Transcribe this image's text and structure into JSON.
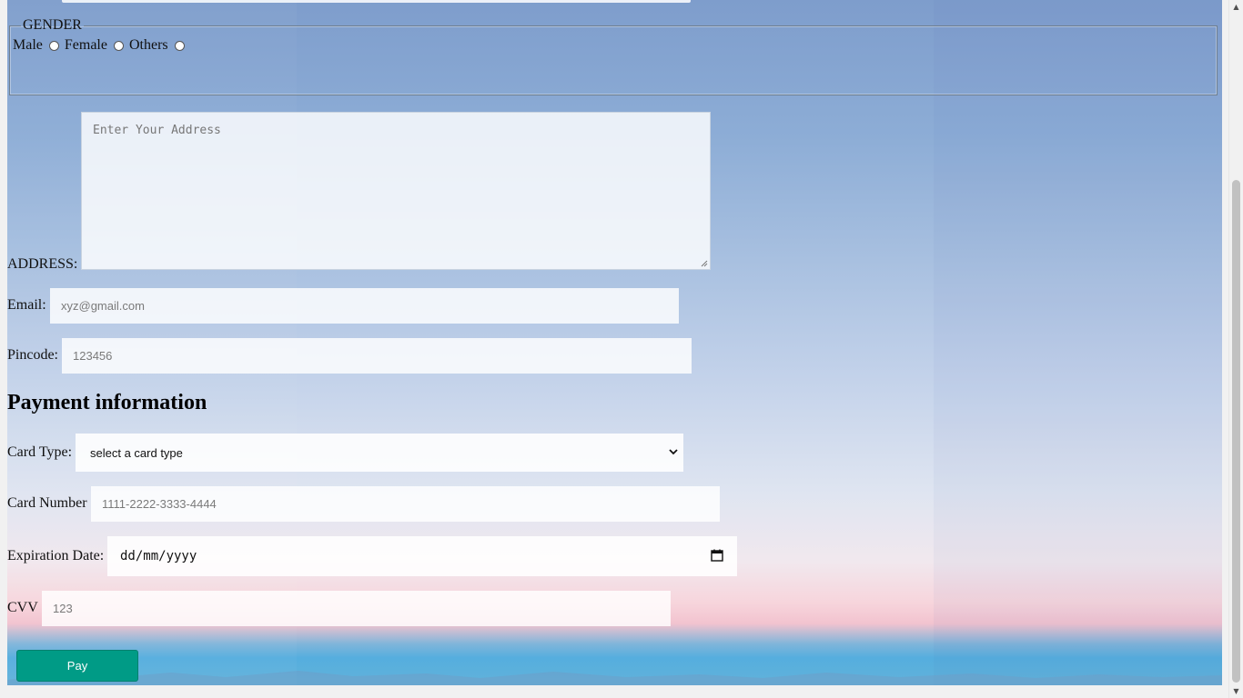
{
  "gender": {
    "legend": "GENDER",
    "options": [
      "Male",
      "Female",
      "Others"
    ]
  },
  "address": {
    "label": "ADDRESS:",
    "placeholder": "Enter Your Address"
  },
  "email": {
    "label": "Email:",
    "placeholder": "xyz@gmail.com"
  },
  "pincode": {
    "label": "Pincode:",
    "placeholder": "123456"
  },
  "payment": {
    "heading": "Payment information",
    "card_type": {
      "label": "Card Type:",
      "selected": "select a card type"
    },
    "card_number": {
      "label": "Card Number",
      "placeholder": "1111-2222-3333-4444"
    },
    "expiration": {
      "label": "Expiration Date:",
      "value": "dd/mm/yyyy"
    },
    "cvv": {
      "label": "CVV",
      "placeholder": "123"
    },
    "pay_label": "Pay"
  },
  "colors": {
    "pay_button": "#009b86",
    "sky_top": "#7e9dcc",
    "horizon_pink": "#f2c3cf",
    "sea_blue": "#55aede"
  },
  "icons": {
    "card_type_dropdown": "chevron-down-icon",
    "expiration_picker": "calendar-icon",
    "address_resize": "resize-grip-icon"
  }
}
